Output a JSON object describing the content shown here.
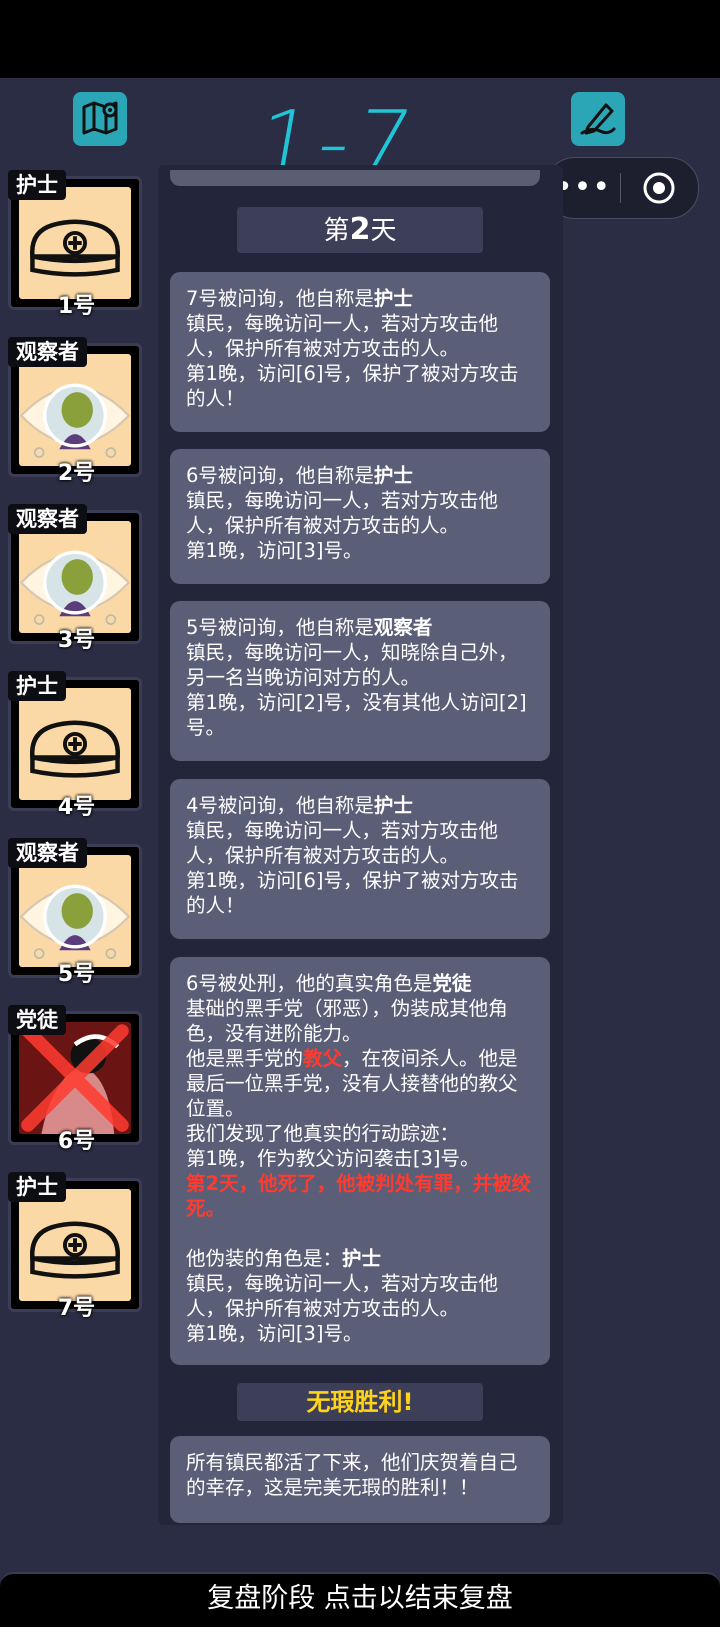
{
  "header": {
    "handwritten_title": "1-7"
  },
  "menu": {
    "more_label": "•••"
  },
  "players": [
    {
      "role": "护士",
      "number": "1号",
      "avatar": "nurse-cap",
      "dead": false
    },
    {
      "role": "观察者",
      "number": "2号",
      "avatar": "watcher-eye",
      "dead": false
    },
    {
      "role": "观察者",
      "number": "3号",
      "avatar": "watcher-eye",
      "dead": false
    },
    {
      "role": "护士",
      "number": "4号",
      "avatar": "nurse-cap",
      "dead": false
    },
    {
      "role": "观察者",
      "number": "5号",
      "avatar": "watcher-eye",
      "dead": false
    },
    {
      "role": "党徒",
      "number": "6号",
      "avatar": "executed-cultist",
      "dead": true
    },
    {
      "role": "护士",
      "number": "7号",
      "avatar": "nurse-cap",
      "dead": false
    }
  ],
  "log": {
    "day_prefix": "第",
    "day_number": "2",
    "day_suffix": "天",
    "messages": [
      {
        "intro": "7号被问询，他自称是",
        "claim": "护士",
        "desc": "镇民，每晚访问一人，若对方攻击他人，保护所有被对方攻击的人。",
        "night": "第1晚，访问[6]号，保护了被对方攻击的人！"
      },
      {
        "intro": "6号被问询，他自称是",
        "claim": "护士",
        "desc": "镇民，每晚访问一人，若对方攻击他人，保护所有被对方攻击的人。",
        "night": "第1晚，访问[3]号。"
      },
      {
        "intro": "5号被问询，他自称是",
        "claim": "观察者",
        "desc": "镇民，每晚访问一人，知晓除自己外，另一名当晚访问对方的人。",
        "night": "第1晚，访问[2]号，没有其他人访问[2]号。"
      },
      {
        "intro": "4号被问询，他自称是",
        "claim": "护士",
        "desc": "镇民，每晚访问一人，若对方攻击他人，保护所有被对方攻击的人。",
        "night": "第1晚，访问[6]号，保护了被对方攻击的人！"
      }
    ],
    "execution": {
      "intro": "6号被处刑，他的真实角色是",
      "true_role": "党徒",
      "role_desc": "基础的黑手党（邪恶），伪装成其他角色，没有进阶能力。",
      "godfather_pre": "他是黑手党的",
      "godfather_word": "教父",
      "godfather_post": "，在夜间杀人。他是最后一位黑手党，没有人接替他的教父位置。",
      "trace_intro": "我们发现了他真实的行动踪迹：",
      "trace_night": "第1晚，作为教父访问袭击[3]号。",
      "death_line": "第2天，他死了，他被判处有罪，并被绞死。",
      "disguise_intro": "他伪装的角色是：",
      "disguise_role": "护士",
      "disguise_desc": "镇民，每晚访问一人，若对方攻击他人，保护所有被对方攻击的人。",
      "disguise_night": "第1晚，访问[3]号。"
    },
    "victory_title": "无瑕胜利!",
    "victory_text": "所有镇民都活了下来，他们庆贺着自己的幸存，这是完美无瑕的胜利！！"
  },
  "footer": {
    "label": "复盘阶段 点击以结束复盘"
  },
  "colors": {
    "background": "#2b2d44",
    "card_fill": "#fbd9a7",
    "message_bg": "#5b5e77",
    "accent_teal": "#2aa6b6",
    "highlight_red": "#ff3b2f",
    "victory_yellow": "#ffd31a"
  }
}
